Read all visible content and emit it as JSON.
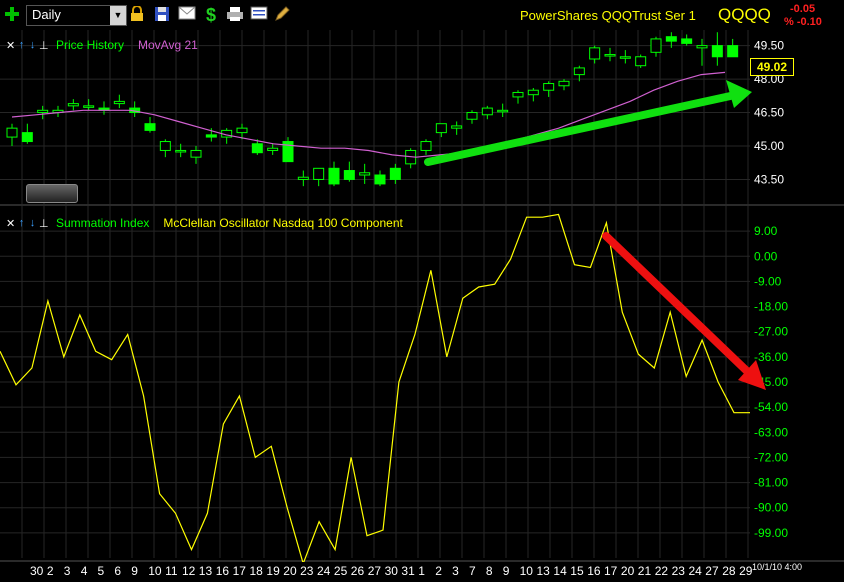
{
  "toolbar": {
    "period": "Daily",
    "icons": [
      "add-icon",
      "lock-icon",
      "save-icon",
      "mail-icon",
      "dollar-icon",
      "print-icon",
      "list-icon",
      "pencil-icon"
    ]
  },
  "header": {
    "title": "PowerShares QQQTrust Ser 1",
    "symbol": "QQQQ",
    "change": "-0.05",
    "change_pct": "% -0.10"
  },
  "panels": {
    "price": {
      "label1": "Price History",
      "label2": "MovAvg 21",
      "last_price": "49.02"
    },
    "osc": {
      "label1": "Summation Index",
      "label2": "McClellan Oscillator Nasdaq 100 Component"
    }
  },
  "colors": {
    "bg": "#000000",
    "up": "#00ff00",
    "text_green": "#00ff00",
    "ma": "#d060d0",
    "osc_line": "#ffff00",
    "yellow": "#ffff00",
    "neg": "#ff2020",
    "grid": "#262626"
  },
  "x_labels": [
    "30",
    "2",
    "3",
    "4",
    "5",
    "6",
    "9",
    "10",
    "11",
    "12",
    "13",
    "16",
    "17",
    "18",
    "19",
    "20",
    "23",
    "24",
    "25",
    "26",
    "27",
    "30",
    "31",
    "1",
    "2",
    "3",
    "7",
    "8",
    "9",
    "10",
    "13",
    "14",
    "15",
    "16",
    "17",
    "20",
    "21",
    "22",
    "23",
    "24",
    "27",
    "28",
    "29"
  ],
  "date_box": "10/1/10 4:00",
  "chart_data": [
    {
      "type": "candlestick",
      "y_ticks": [
        "49.50",
        "48.00",
        "46.50",
        "45.00",
        "43.50"
      ],
      "ylim": [
        42.4,
        50.2
      ],
      "ohlc": [
        [
          45.4,
          46.0,
          45.0,
          45.8
        ],
        [
          45.6,
          46.0,
          45.1,
          45.2
        ],
        [
          46.5,
          46.8,
          46.2,
          46.6
        ],
        [
          46.5,
          46.8,
          46.3,
          46.6
        ],
        [
          46.8,
          47.1,
          46.6,
          46.9
        ],
        [
          46.8,
          47.1,
          46.6,
          46.8
        ],
        [
          46.7,
          47.0,
          46.4,
          46.6
        ],
        [
          46.9,
          47.3,
          46.7,
          47.0
        ],
        [
          46.7,
          47.0,
          46.3,
          46.5
        ],
        [
          46.0,
          46.3,
          45.6,
          45.7
        ],
        [
          44.8,
          45.3,
          44.5,
          45.2
        ],
        [
          44.8,
          45.1,
          44.5,
          44.8
        ],
        [
          44.5,
          45.0,
          44.2,
          44.8
        ],
        [
          45.5,
          45.8,
          45.2,
          45.4
        ],
        [
          45.4,
          45.8,
          45.1,
          45.7
        ],
        [
          45.6,
          46.0,
          45.3,
          45.8
        ],
        [
          45.1,
          45.3,
          44.6,
          44.7
        ],
        [
          44.8,
          45.1,
          44.6,
          44.9
        ],
        [
          45.2,
          45.4,
          44.3,
          44.3
        ],
        [
          43.5,
          43.9,
          43.2,
          43.6
        ],
        [
          43.5,
          44.0,
          43.2,
          44.0
        ],
        [
          44.0,
          44.3,
          43.2,
          43.3
        ],
        [
          43.9,
          44.3,
          43.4,
          43.5
        ],
        [
          43.7,
          44.2,
          43.3,
          43.8
        ],
        [
          43.7,
          43.9,
          43.2,
          43.3
        ],
        [
          44.0,
          44.2,
          43.3,
          43.5
        ],
        [
          44.2,
          44.9,
          44.0,
          44.8
        ],
        [
          44.8,
          45.3,
          44.6,
          45.2
        ],
        [
          45.6,
          46.0,
          45.4,
          46.0
        ],
        [
          45.8,
          46.1,
          45.5,
          45.9
        ],
        [
          46.2,
          46.6,
          46.0,
          46.5
        ],
        [
          46.4,
          46.8,
          46.2,
          46.7
        ],
        [
          46.6,
          46.9,
          46.3,
          46.6
        ],
        [
          47.2,
          47.5,
          46.9,
          47.4
        ],
        [
          47.3,
          47.6,
          47.0,
          47.5
        ],
        [
          47.5,
          47.9,
          47.2,
          47.8
        ],
        [
          47.7,
          48.0,
          47.5,
          47.9
        ],
        [
          48.2,
          48.6,
          47.9,
          48.5
        ],
        [
          48.9,
          49.5,
          48.7,
          49.4
        ],
        [
          49.1,
          49.4,
          48.8,
          49.1
        ],
        [
          49.0,
          49.3,
          48.7,
          49.0
        ],
        [
          48.6,
          49.1,
          48.5,
          49.0
        ],
        [
          49.2,
          49.9,
          49.0,
          49.8
        ],
        [
          49.9,
          50.1,
          49.4,
          49.7
        ],
        [
          49.8,
          50.0,
          49.5,
          49.6
        ],
        [
          49.4,
          49.8,
          48.6,
          49.5
        ],
        [
          49.5,
          50.1,
          48.6,
          49.0
        ],
        [
          49.5,
          49.8,
          49.0,
          49.0
        ]
      ],
      "ma21": [
        46.3,
        46.4,
        46.5,
        46.6,
        46.6,
        46.6,
        46.4,
        46.1,
        45.8,
        45.5,
        45.3,
        45.1,
        45.0,
        44.9,
        44.9,
        44.8,
        44.6,
        44.5,
        44.6,
        44.7,
        45.0,
        45.2,
        45.5,
        45.8,
        46.2,
        46.6,
        47.0,
        47.5,
        47.9,
        48.2,
        48.3
      ],
      "ma21_x0": 0,
      "ma21_step": 1.55
    },
    {
      "type": "line",
      "y_ticks": [
        "9.00",
        "0.00",
        "-9.00",
        "-18.00",
        "-27.00",
        "-36.00",
        "-45.00",
        "-54.00",
        "-63.00",
        "-72.00",
        "-81.00",
        "-90.00",
        "-99.00"
      ],
      "ylim": [
        -108,
        18
      ],
      "values": [
        -34,
        -46,
        -40,
        -16,
        -36,
        -21,
        -34,
        -37,
        -28,
        -50,
        -85,
        -92,
        -105,
        -92,
        -60,
        -50,
        -72,
        -68,
        -90,
        -110,
        -95,
        -105,
        -72,
        -100,
        -98,
        -45,
        -28,
        -5,
        -36,
        -15,
        -11,
        -10,
        -1,
        14,
        14,
        15,
        -3,
        -4,
        12,
        -20,
        -35,
        -40,
        -20,
        -43,
        -30,
        -45,
        -56,
        -56
      ]
    }
  ]
}
